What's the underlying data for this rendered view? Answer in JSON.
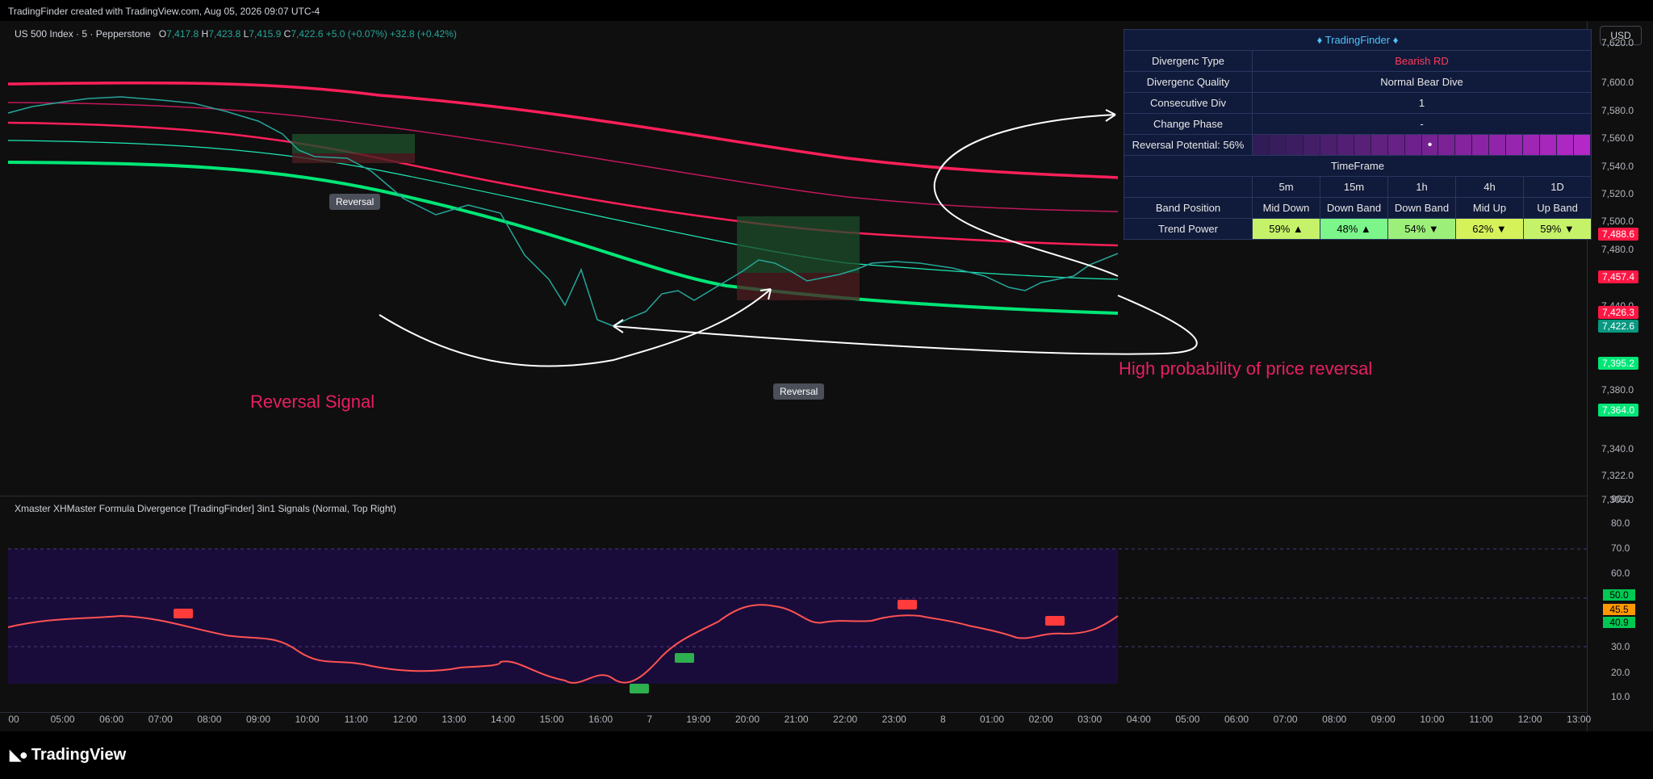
{
  "topbar": {
    "text": "TradingFinder created with TradingView.com, Aug 05, 2026 09:07 UTC-4"
  },
  "symbol": {
    "name": "US 500 Index · 5 · Pepperstone",
    "o_label": "O",
    "o": "7,417.8",
    "h_label": "H",
    "h": "7,423.8",
    "l_label": "L",
    "l": "7,415.9",
    "c_label": "C",
    "c": "7,422.6",
    "chg": "+5.0 (+0.07%)",
    "chg2": "+32.8 (+0.42%)"
  },
  "currency": "USD",
  "price_axis": [
    "7,620.0",
    "7,600.0",
    "7,580.0",
    "7,560.0",
    "7,540.0",
    "7,520.0",
    "7,500.0",
    "7,480.0",
    "7,440.0",
    "7,420.0",
    "7,380.0",
    "7,340.0",
    "7,322.0",
    "7,305.0"
  ],
  "price_tags": [
    {
      "value": "7,488.6",
      "color": "#ff1744"
    },
    {
      "value": "7,457.4",
      "color": "#ff1744"
    },
    {
      "value": "7,426.3",
      "color": "#ff1744"
    },
    {
      "value": "7,422.6",
      "color": "#089981"
    },
    {
      "value": "7,395.2",
      "color": "#00e676"
    },
    {
      "value": "7,364.0",
      "color": "#00e676"
    }
  ],
  "indicator": {
    "title": "Xmaster XHMaster Formula Divergence [TradingFinder] 3in1 Signals (Normal, Top Right)",
    "axis": [
      "90.0",
      "80.0",
      "70.0",
      "60.0",
      "40.0",
      "30.0",
      "20.0",
      "10.0"
    ],
    "tags": [
      {
        "value": "50.0",
        "color": "#00c853"
      },
      {
        "value": "45.5",
        "color": "#ff9800"
      },
      {
        "value": "40.9",
        "color": "#00c853"
      }
    ],
    "badges": [
      "-RD",
      "+RD"
    ]
  },
  "time_axis": [
    "00",
    "05:00",
    "06:00",
    "07:00",
    "08:00",
    "09:00",
    "10:00",
    "11:00",
    "12:00",
    "13:00",
    "14:00",
    "15:00",
    "16:00",
    "7",
    "19:00",
    "20:00",
    "21:00",
    "22:00",
    "23:00",
    "8",
    "01:00",
    "02:00",
    "03:00",
    "04:00",
    "05:00",
    "06:00",
    "07:00",
    "08:00",
    "09:00",
    "10:00",
    "11:00",
    "12:00",
    "13:00"
  ],
  "table": {
    "title": "♦ TradingFinder ♦",
    "rows": [
      {
        "label": "Divergenc Type",
        "value": "Bearish RD"
      },
      {
        "label": "Divergenc Quality",
        "value": "Normal Bear Dive"
      },
      {
        "label": "Consecutive Div",
        "value": "1"
      },
      {
        "label": "Change Phase",
        "value": "-"
      }
    ],
    "reversal_label": "Reversal Potential: 56%",
    "reversal_potential": 0.56,
    "timeframe_title": "TimeFrame",
    "timeframes": [
      "5m",
      "15m",
      "1h",
      "4h",
      "1D"
    ],
    "band_label": "Band Position",
    "bands": [
      "Mid Down",
      "Down Band",
      "Down Band",
      "Mid Up",
      "Up Band"
    ],
    "power_label": "Trend Power",
    "powers": [
      "59% ▲",
      "48% ▲",
      "54% ▼",
      "62% ▼",
      "59% ▼"
    ],
    "power_colors": [
      "#c6f26a",
      "#7cf58a",
      "#9cf07a",
      "#d6f25a",
      "#c6f26a"
    ]
  },
  "annotations": {
    "left": "Reversal Signal",
    "right": "High probability of price reversal",
    "box": "Reversal"
  },
  "logo": "TradingView"
}
